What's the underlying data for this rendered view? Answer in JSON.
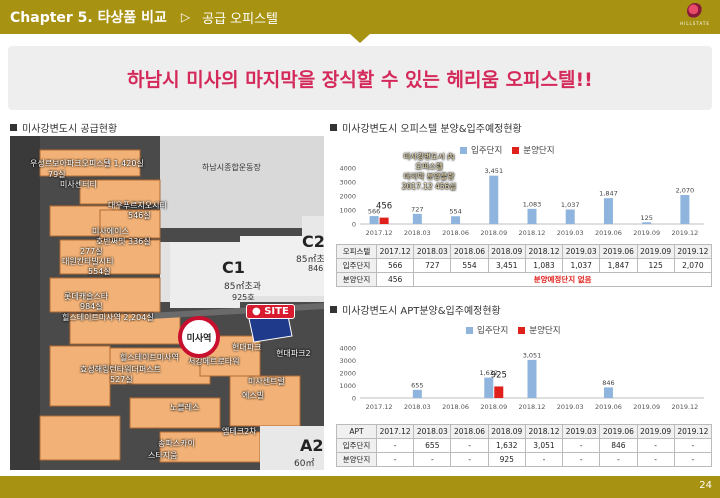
{
  "header": {
    "chapter": "Chapter 5. 타상품 비교",
    "arrow": "▷",
    "subtitle": "공급 오피스텔",
    "logo_text": "HILLSTATE"
  },
  "banner": {
    "title": "하남시 미사의 마지막을 장식할 수 있는 헤리움 오피스텔!!"
  },
  "sections": {
    "map_title": "미사강변도시 공급현황",
    "chart1_title": "미사강변도시 오피스텔 분양&입주예정현황",
    "chart2_title": "미사강변도시 APT분양&입주예정현황"
  },
  "map": {
    "top_label": "하남시종합운동장",
    "labels": [
      "우성르보아파크오피스텔 1,420실",
      "79실",
      "미사센터티",
      "대우푸르지오시티",
      "546실",
      "호반써밋 336실",
      "미사에이스",
      "277실",
      "대원칸타빌시티",
      "554실",
      "롯데캐슬스타",
      "984실",
      "힐스테이트미사역 2,204실",
      "힐스테이트미사역",
      "효성해링턴타워더퍼스트",
      "527실",
      "서강메트로타워",
      "현대파크",
      "현대파크2",
      "미사센트럴",
      "에스빌",
      "노블레스",
      "엠테크2차",
      "송파스카이",
      "스타지움"
    ],
    "lot_c1": "C1",
    "lot_c1_area": "85㎡초과",
    "lot_c1_units": "925호",
    "lot_c2": "C2",
    "lot_c2_area": "85㎡초",
    "lot_c2_units": "846",
    "lot_a2": "A2",
    "lot_a2_area": "60㎡",
    "site_label": "SITE",
    "station_label": "미사역"
  },
  "legend": {
    "move_in": "입주단지",
    "sale": "분양단지"
  },
  "colors": {
    "header": "#a89212",
    "move_in": "#8fb4dd",
    "sale": "#e0201b",
    "accent": "#d42a5b"
  },
  "chart1_callout": [
    "미사강변도시 內",
    "오피스텔",
    "마지막 분양물량",
    "2017.12 456실"
  ],
  "chart_data": [
    {
      "type": "bar",
      "categories": [
        "2017.12",
        "2018.03",
        "2018.06",
        "2018.09",
        "2018.12",
        "2019.03",
        "2019.06",
        "2019.09",
        "2019.12"
      ],
      "series": [
        {
          "name": "입주단지",
          "values": [
            566,
            727,
            554,
            3451,
            1083,
            1037,
            1847,
            125,
            2070
          ]
        },
        {
          "name": "분양단지",
          "values": [
            456,
            null,
            null,
            null,
            null,
            null,
            null,
            null,
            null
          ]
        }
      ],
      "ylim": [
        0,
        4000
      ],
      "yticks": [
        "0",
        "1000",
        "2000",
        "3000",
        "4000"
      ],
      "data_labels": [
        "566",
        "727",
        "554",
        "3,451",
        "1,083",
        "1,037",
        "1,847",
        "125",
        "2,070"
      ],
      "sale_labels": [
        "456",
        "",
        "",
        "",
        "",
        "",
        "",
        "",
        ""
      ]
    },
    {
      "type": "bar",
      "categories": [
        "2017.12",
        "2018.03",
        "2018.06",
        "2018.09",
        "2018.12",
        "2019.03",
        "2019.06",
        "2019.09",
        "2019.12"
      ],
      "series": [
        {
          "name": "입주단지",
          "values": [
            null,
            655,
            null,
            1632,
            3051,
            null,
            846,
            null,
            null
          ]
        },
        {
          "name": "분양단지",
          "values": [
            null,
            null,
            null,
            925,
            null,
            null,
            null,
            null,
            null
          ]
        }
      ],
      "ylim": [
        0,
        4000
      ],
      "yticks": [
        "0",
        "1000",
        "2000",
        "3000",
        "4000"
      ],
      "data_labels": [
        "",
        "655",
        "",
        "1,632",
        "3,051",
        "",
        "846",
        "",
        ""
      ],
      "sale_labels": [
        "",
        "",
        "",
        "925",
        "",
        "",
        "",
        "",
        ""
      ]
    }
  ],
  "table1": {
    "header": [
      "오피스텔",
      "2017.12",
      "2018.03",
      "2018.06",
      "2018.09",
      "2018.12",
      "2019.03",
      "2019.06",
      "2019.09",
      "2019.12"
    ],
    "move_in": [
      "입주단지",
      "566",
      "727",
      "554",
      "3,451",
      "1,083",
      "1,037",
      "1,847",
      "125",
      "2,070"
    ],
    "sale_label": "분양단지",
    "sale_first": "456",
    "sale_note": "분양예정단지 없음"
  },
  "table2": {
    "header": [
      "APT",
      "2017.12",
      "2018.03",
      "2018.06",
      "2018.09",
      "2018.12",
      "2019.03",
      "2019.06",
      "2019.09",
      "2019.12"
    ],
    "move_in": [
      "입주단지",
      "-",
      "655",
      "-",
      "1,632",
      "3,051",
      "-",
      "846",
      "-",
      "-"
    ],
    "sale": [
      "분양단지",
      "-",
      "-",
      "-",
      "925",
      "-",
      "-",
      "-",
      "-",
      "-"
    ]
  },
  "footer": {
    "page": "24"
  }
}
